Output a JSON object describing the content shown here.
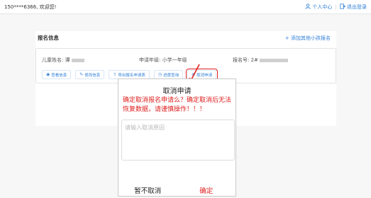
{
  "header": {
    "welcome": "150****6366, 欢迎您!",
    "personal_center": "个人中心",
    "logout": "退出登录",
    "separator": "|",
    "icons": [
      "user-icon",
      "logout-icon"
    ]
  },
  "card": {
    "title": "报名信息",
    "add_child": "+ 添加其他小孩报名",
    "child_name_label": "儿童姓名:",
    "child_name_value": "谭",
    "grade": "申请年级: 小学一年级",
    "reg_no_label": "报名号:",
    "reg_no_value": "2#",
    "buttons": [
      {
        "label": "查看信息",
        "icon": "eye-icon",
        "glyph": "◉"
      },
      {
        "label": "修改信息",
        "icon": "pencil-icon",
        "glyph": "✎"
      },
      {
        "label": "导出报名申请表",
        "icon": "export-icon",
        "glyph": "⇪"
      },
      {
        "label": "进度查询",
        "icon": "clock-icon",
        "glyph": "◷"
      },
      {
        "label": "取消申请",
        "icon": "cancel-icon",
        "glyph": "⊗"
      }
    ]
  },
  "dialog": {
    "title": "取消申请",
    "warning": "确定取消报名申请么？确定取消后无法恢复数据，请谨慎操作！！！",
    "reason_placeholder": "请输入取消原因",
    "reason_value": "",
    "cancel_label": "暂不取消",
    "confirm_label": "确定"
  },
  "colors": {
    "accent": "#2f7fd8",
    "danger": "#e02020"
  }
}
